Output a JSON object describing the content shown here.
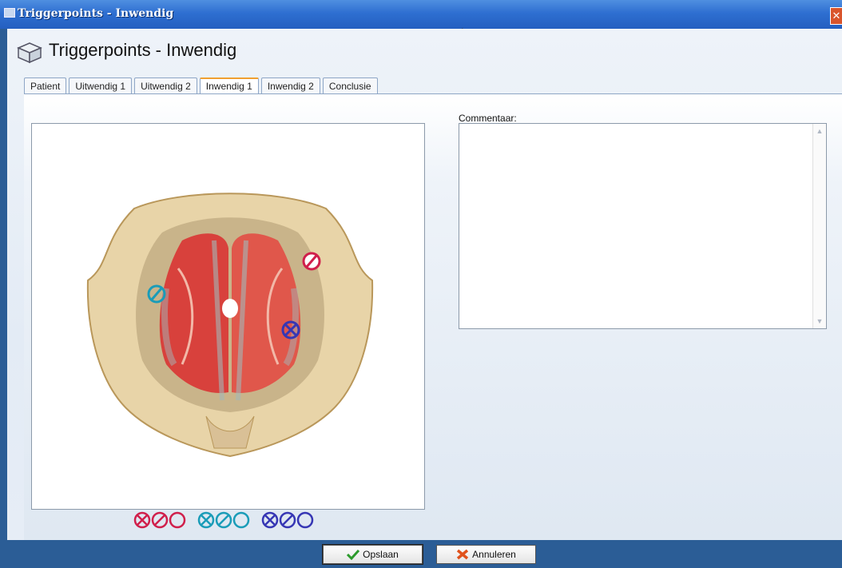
{
  "window": {
    "title": "Triggerpoints - Inwendig",
    "close_glyph": "✕"
  },
  "header": {
    "title": "Triggerpoints - Inwendig",
    "icon": "box-icon"
  },
  "tabs": [
    {
      "label": "Patient"
    },
    {
      "label": "Uitwendig 1"
    },
    {
      "label": "Uitwendig 2"
    },
    {
      "label": "Inwendig 1",
      "active": true
    },
    {
      "label": "Inwendig 2"
    },
    {
      "label": "Conclusie"
    }
  ],
  "comment": {
    "label": "Commentaar:",
    "value": ""
  },
  "legend": {
    "colors": {
      "red": "#d01f4b",
      "teal": "#1a9cb8",
      "blue": "#3636b4"
    }
  },
  "footer": {
    "save_label": "Opslaan",
    "cancel_label": "Annuleren"
  }
}
